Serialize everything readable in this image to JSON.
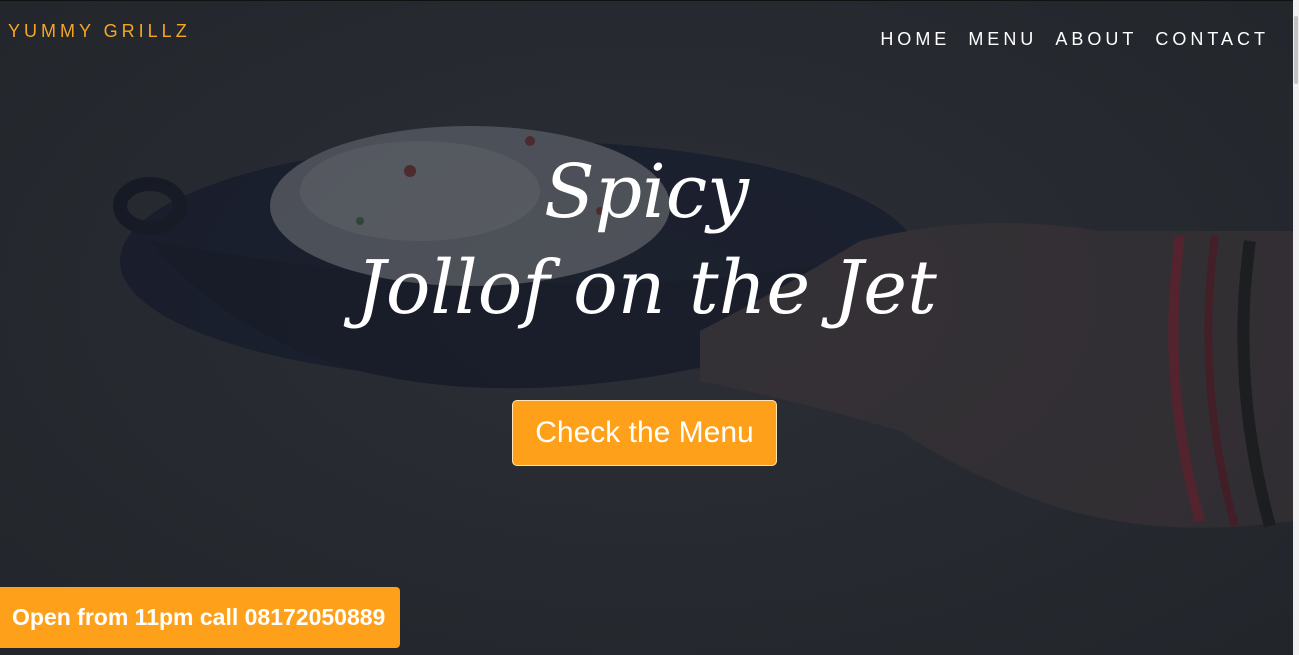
{
  "brand": {
    "name": "YUMMY GRILLZ",
    "color": "#f5a623"
  },
  "nav": {
    "items": [
      "HOME",
      "MENU",
      "ABOUT",
      "CONTACT"
    ]
  },
  "hero": {
    "line1": "Spicy",
    "line2": "Jollof on the Jet",
    "cta_label": "Check the Menu",
    "cta_color": "#ffa01a"
  },
  "ribbon": {
    "text": "Open from 11pm call 08172050889"
  }
}
